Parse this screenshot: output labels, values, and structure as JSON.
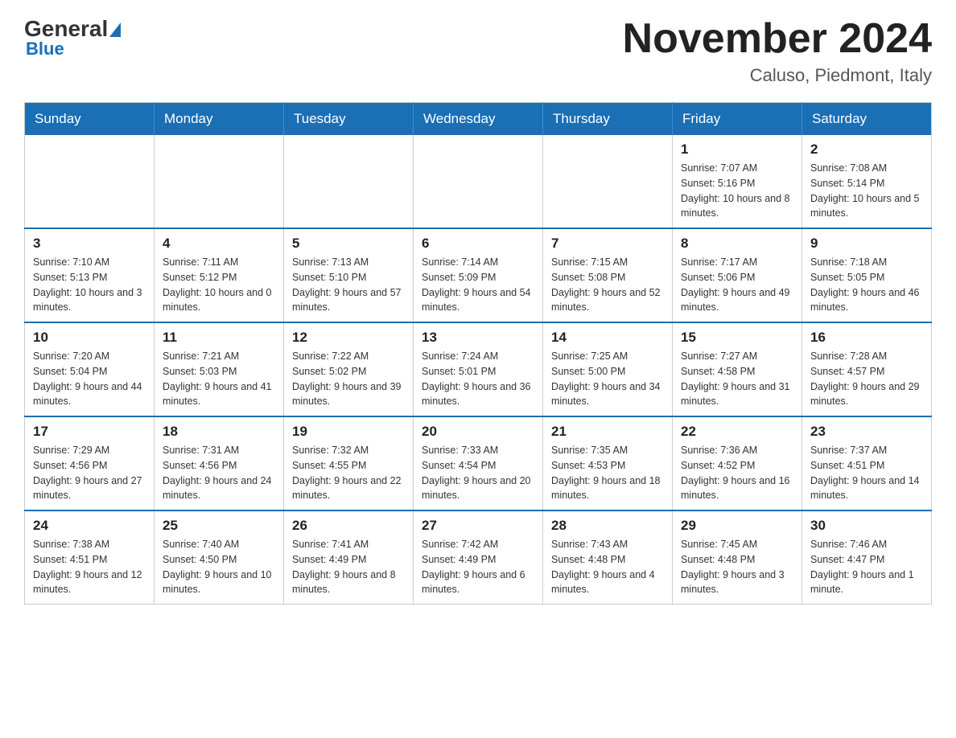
{
  "logo": {
    "general": "General",
    "blue": "Blue"
  },
  "header": {
    "month_year": "November 2024",
    "location": "Caluso, Piedmont, Italy"
  },
  "days_of_week": [
    "Sunday",
    "Monday",
    "Tuesday",
    "Wednesday",
    "Thursday",
    "Friday",
    "Saturday"
  ],
  "weeks": [
    [
      {
        "day": "",
        "info": ""
      },
      {
        "day": "",
        "info": ""
      },
      {
        "day": "",
        "info": ""
      },
      {
        "day": "",
        "info": ""
      },
      {
        "day": "",
        "info": ""
      },
      {
        "day": "1",
        "info": "Sunrise: 7:07 AM\nSunset: 5:16 PM\nDaylight: 10 hours and 8 minutes."
      },
      {
        "day": "2",
        "info": "Sunrise: 7:08 AM\nSunset: 5:14 PM\nDaylight: 10 hours and 5 minutes."
      }
    ],
    [
      {
        "day": "3",
        "info": "Sunrise: 7:10 AM\nSunset: 5:13 PM\nDaylight: 10 hours and 3 minutes."
      },
      {
        "day": "4",
        "info": "Sunrise: 7:11 AM\nSunset: 5:12 PM\nDaylight: 10 hours and 0 minutes."
      },
      {
        "day": "5",
        "info": "Sunrise: 7:13 AM\nSunset: 5:10 PM\nDaylight: 9 hours and 57 minutes."
      },
      {
        "day": "6",
        "info": "Sunrise: 7:14 AM\nSunset: 5:09 PM\nDaylight: 9 hours and 54 minutes."
      },
      {
        "day": "7",
        "info": "Sunrise: 7:15 AM\nSunset: 5:08 PM\nDaylight: 9 hours and 52 minutes."
      },
      {
        "day": "8",
        "info": "Sunrise: 7:17 AM\nSunset: 5:06 PM\nDaylight: 9 hours and 49 minutes."
      },
      {
        "day": "9",
        "info": "Sunrise: 7:18 AM\nSunset: 5:05 PM\nDaylight: 9 hours and 46 minutes."
      }
    ],
    [
      {
        "day": "10",
        "info": "Sunrise: 7:20 AM\nSunset: 5:04 PM\nDaylight: 9 hours and 44 minutes."
      },
      {
        "day": "11",
        "info": "Sunrise: 7:21 AM\nSunset: 5:03 PM\nDaylight: 9 hours and 41 minutes."
      },
      {
        "day": "12",
        "info": "Sunrise: 7:22 AM\nSunset: 5:02 PM\nDaylight: 9 hours and 39 minutes."
      },
      {
        "day": "13",
        "info": "Sunrise: 7:24 AM\nSunset: 5:01 PM\nDaylight: 9 hours and 36 minutes."
      },
      {
        "day": "14",
        "info": "Sunrise: 7:25 AM\nSunset: 5:00 PM\nDaylight: 9 hours and 34 minutes."
      },
      {
        "day": "15",
        "info": "Sunrise: 7:27 AM\nSunset: 4:58 PM\nDaylight: 9 hours and 31 minutes."
      },
      {
        "day": "16",
        "info": "Sunrise: 7:28 AM\nSunset: 4:57 PM\nDaylight: 9 hours and 29 minutes."
      }
    ],
    [
      {
        "day": "17",
        "info": "Sunrise: 7:29 AM\nSunset: 4:56 PM\nDaylight: 9 hours and 27 minutes."
      },
      {
        "day": "18",
        "info": "Sunrise: 7:31 AM\nSunset: 4:56 PM\nDaylight: 9 hours and 24 minutes."
      },
      {
        "day": "19",
        "info": "Sunrise: 7:32 AM\nSunset: 4:55 PM\nDaylight: 9 hours and 22 minutes."
      },
      {
        "day": "20",
        "info": "Sunrise: 7:33 AM\nSunset: 4:54 PM\nDaylight: 9 hours and 20 minutes."
      },
      {
        "day": "21",
        "info": "Sunrise: 7:35 AM\nSunset: 4:53 PM\nDaylight: 9 hours and 18 minutes."
      },
      {
        "day": "22",
        "info": "Sunrise: 7:36 AM\nSunset: 4:52 PM\nDaylight: 9 hours and 16 minutes."
      },
      {
        "day": "23",
        "info": "Sunrise: 7:37 AM\nSunset: 4:51 PM\nDaylight: 9 hours and 14 minutes."
      }
    ],
    [
      {
        "day": "24",
        "info": "Sunrise: 7:38 AM\nSunset: 4:51 PM\nDaylight: 9 hours and 12 minutes."
      },
      {
        "day": "25",
        "info": "Sunrise: 7:40 AM\nSunset: 4:50 PM\nDaylight: 9 hours and 10 minutes."
      },
      {
        "day": "26",
        "info": "Sunrise: 7:41 AM\nSunset: 4:49 PM\nDaylight: 9 hours and 8 minutes."
      },
      {
        "day": "27",
        "info": "Sunrise: 7:42 AM\nSunset: 4:49 PM\nDaylight: 9 hours and 6 minutes."
      },
      {
        "day": "28",
        "info": "Sunrise: 7:43 AM\nSunset: 4:48 PM\nDaylight: 9 hours and 4 minutes."
      },
      {
        "day": "29",
        "info": "Sunrise: 7:45 AM\nSunset: 4:48 PM\nDaylight: 9 hours and 3 minutes."
      },
      {
        "day": "30",
        "info": "Sunrise: 7:46 AM\nSunset: 4:47 PM\nDaylight: 9 hours and 1 minute."
      }
    ]
  ]
}
